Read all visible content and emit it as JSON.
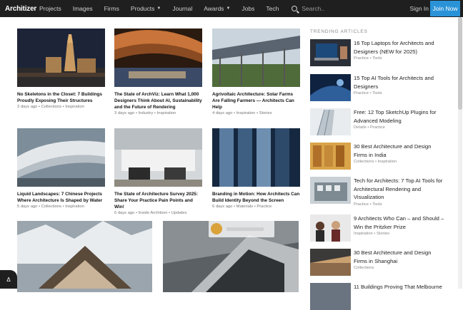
{
  "nav": {
    "logo": "Architizer",
    "links": [
      {
        "label": "Projects",
        "has_caret": false
      },
      {
        "label": "Images",
        "has_caret": false
      },
      {
        "label": "Firms",
        "has_caret": false
      },
      {
        "label": "Products",
        "has_caret": true
      },
      {
        "label": "Journal",
        "has_caret": false
      },
      {
        "label": "Awards",
        "has_caret": true
      },
      {
        "label": "Jobs",
        "has_caret": false
      },
      {
        "label": "Tech",
        "has_caret": false
      }
    ],
    "search_placeholder": "Search..",
    "sign_in": "Sign In",
    "join_now": "Join Now",
    "accent_color": "#2a93d8"
  },
  "articles": [
    {
      "title": "No Skeletons in the Closet: 7 Buildings Proudly Exposing Their Structures",
      "meta": "3 days ago • Collections • Inspiration"
    },
    {
      "title": "The State of ArchViz: Learn What 1,000 Designers Think About AI, Sustainability and the Future of Rendering",
      "meta": "3 days ago • Industry • Inspiration"
    },
    {
      "title": "Agrivoltaic Architecture: Solar Farms Are Falling Farmers — Architects Can Help",
      "meta": "4 days ago • Inspiration • Stories"
    },
    {
      "title": "Liquid Landscapes: 7 Chinese Projects Where Architecture Is Shaped by Water",
      "meta": "5 days ago • Collections • Inspiration"
    },
    {
      "title": "The State of Architecture Survey 2025: Share Your Practice Pain Points and Win!",
      "meta": "6 days ago • Inside Architizer • Updates"
    },
    {
      "title": "Branding in Motion: How Architects Can Build Identity Beyond the Screen",
      "meta": "6 days ago • Materials • Practice"
    }
  ],
  "sidebar": {
    "heading": "TRENDING ARTICLES",
    "items": [
      {
        "title": "16 Top Laptops for Architects and Designers (NEW for 2025)",
        "meta": "Practice • Tools"
      },
      {
        "title": "15 Top AI Tools for Architects and Designers",
        "meta": "Practice • Tools"
      },
      {
        "title": "Free: 12 Top SketchUp Plugins for Advanced Modeling",
        "meta": "Details • Practice"
      },
      {
        "title": "30 Best Architecture and Design Firms in India",
        "meta": "Collections • Inspiration"
      },
      {
        "title": "Tech for Architects: 7 Top AI Tools for Architectural Rendering and Visualization",
        "meta": "Practice • Tools"
      },
      {
        "title": "9 Architects Who Can – and Should – Win the Pritzker Prize",
        "meta": "Inspiration • Stories"
      },
      {
        "title": "30 Best Architecture and Design Firms in Shanghai",
        "meta": "Collections"
      },
      {
        "title": "11 Buildings Proving That Melbourne",
        "meta": ""
      }
    ]
  },
  "feedback_label": "Δ"
}
